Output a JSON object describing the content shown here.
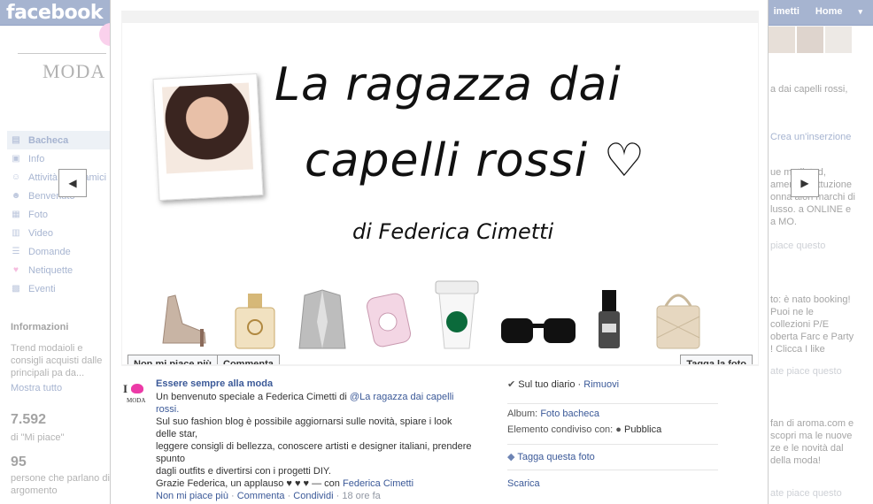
{
  "topbar": {
    "logo": "facebook",
    "right_links": [
      "imetti",
      "Home"
    ],
    "arrow": "▾"
  },
  "left": {
    "logo_text": "MODA",
    "nav": [
      {
        "label": "Bacheca",
        "icon": "wall-icon"
      },
      {
        "label": "Info",
        "icon": "info-icon"
      },
      {
        "label": "Attività degli amici",
        "icon": "friends-activity-icon"
      },
      {
        "label": "Benvenuto",
        "icon": "welcome-icon"
      },
      {
        "label": "Foto",
        "icon": "photo-icon"
      },
      {
        "label": "Video",
        "icon": "video-icon"
      },
      {
        "label": "Domande",
        "icon": "questions-icon"
      },
      {
        "label": "Netiquette",
        "icon": "heart-icon"
      },
      {
        "label": "Eventi",
        "icon": "calendar-icon"
      }
    ],
    "info_title": "Informazioni",
    "info_text": "Trend modaioli e consigli acquisti dalle principali pa da...",
    "info_link": "Mostra tutto",
    "likes_count": "7.592",
    "likes_label": "di \"Mi piace\"",
    "talking_count": "95",
    "talking_label": "persone che parlano di argomento"
  },
  "right": {
    "text1": "a dai capelli rossi,",
    "create_ad": "Crea un'inserzione",
    "text2": "ue mutilated, ament un'i ttuzione onna aiori marchi di lusso. a ONLINE e a MO.",
    "like1": "piace questo",
    "text3": "to: è nato booking! Puoi ne le collezioni P/E oberta Farc e Party ! Clicca I like",
    "like2": "ate piace questo",
    "text4": "fan di aroma.com e scopri ma le nuove ze e le novità dal della moda!",
    "like3": "ate piace questo"
  },
  "photo": {
    "title_line1": "La ragazza dai",
    "title_line2": "capelli rossi ♡",
    "subtitle": "di Federica Cimetti",
    "unlike_button": "Non mi piace più",
    "comment_button": "Commenta",
    "tag_button": "Tagga la foto"
  },
  "post": {
    "author": "Essere sempre alla moda",
    "text_prefix": "Un benvenuto speciale a Federica Cimetti di ",
    "text_tag": "@La ragazza dai capelli rossi.",
    "text_body": "Sul suo fashion blog è possibile aggiornarsi sulle novità, spiare i look delle star,",
    "text_body2": "leggere consigli di bellezza, conoscere artisti e designer italiani, prendere spunto",
    "text_body3": "dagli outfits e divertirsi con i progetti DIY.",
    "text_body4": "Grazie Federica, un applauso ♥ ♥ ♥ — con ",
    "with_person": "Federica Cimetti",
    "action_unlike": "Non mi piace più",
    "action_comment": "Commenta",
    "action_share": "Condividi",
    "time": "18 ore fa",
    "logo_i": "I",
    "logo_moda": "MODA"
  },
  "meta": {
    "check": "✔",
    "diary": "Sul tuo diario",
    "remove": "Rimuovi",
    "album_label": "Album:",
    "album_value": "Foto bacheca",
    "shared_label": "Elemento condiviso con:",
    "shared_value": "Pubblica",
    "tag_photo": "Tagga questa foto",
    "download": "Scarica"
  }
}
